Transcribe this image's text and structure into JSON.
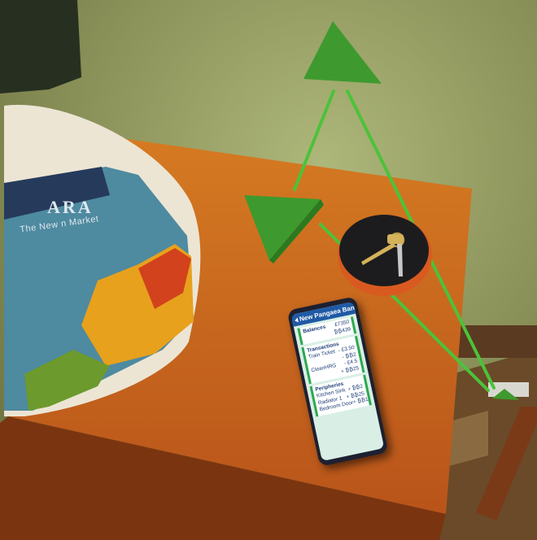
{
  "bag": {
    "brand_text": "ARA",
    "tagline": "The New     n Market"
  },
  "phone": {
    "bank_name": "New Pangaea Bank",
    "balances": {
      "title": "Balances",
      "values": [
        "£7350",
        "₿₿439"
      ]
    },
    "transactions": {
      "title": "Transactions",
      "items": [
        {
          "label": "Train Ticket",
          "values": [
            "- £3.50",
            "- ₿₿2"
          ]
        },
        {
          "label": "CleanHRG",
          "values": [
            "- £4.5",
            "+ ₿₿25"
          ]
        }
      ]
    },
    "peripheries": {
      "title": "Peripheries",
      "items": [
        {
          "label": "Kitchen Sink",
          "value": "+ ₿₿2"
        },
        {
          "label": "Radiator 1",
          "value": "+ ₿₿25"
        },
        {
          "label": "Bedroom Door",
          "value": "+ ₿₿1"
        }
      ]
    }
  },
  "colors": {
    "triangle": "#3e9a2e",
    "beam": "#4cc23a",
    "wall": "#a3ad70",
    "desk": "#c8661a",
    "bank_header": "#1f5aa6"
  }
}
